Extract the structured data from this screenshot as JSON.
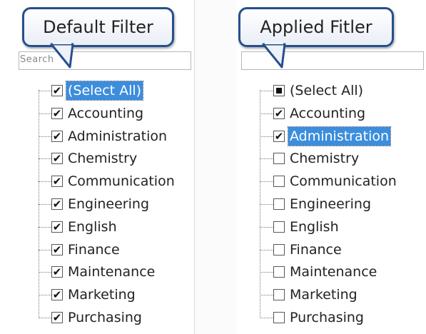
{
  "callouts": {
    "left": "Default Filter",
    "right": "Applied Fitler"
  },
  "search": {
    "ghost_label": "Search"
  },
  "left_list": [
    {
      "label": "(Select All)",
      "state": "checked",
      "selected": true
    },
    {
      "label": "Accounting",
      "state": "checked",
      "selected": false
    },
    {
      "label": "Administration",
      "state": "checked",
      "selected": false
    },
    {
      "label": "Chemistry",
      "state": "checked",
      "selected": false
    },
    {
      "label": "Communication",
      "state": "checked",
      "selected": false
    },
    {
      "label": "Engineering",
      "state": "checked",
      "selected": false
    },
    {
      "label": "English",
      "state": "checked",
      "selected": false
    },
    {
      "label": "Finance",
      "state": "checked",
      "selected": false
    },
    {
      "label": "Maintenance",
      "state": "checked",
      "selected": false
    },
    {
      "label": "Marketing",
      "state": "checked",
      "selected": false
    },
    {
      "label": "Purchasing",
      "state": "checked",
      "selected": false
    }
  ],
  "right_list": [
    {
      "label": "(Select All)",
      "state": "indeterminate",
      "selected": false
    },
    {
      "label": "Accounting",
      "state": "checked",
      "selected": false
    },
    {
      "label": "Administration",
      "state": "checked",
      "selected": true
    },
    {
      "label": "Chemistry",
      "state": "unchecked",
      "selected": false
    },
    {
      "label": "Communication",
      "state": "unchecked",
      "selected": false
    },
    {
      "label": "Engineering",
      "state": "unchecked",
      "selected": false
    },
    {
      "label": "English",
      "state": "unchecked",
      "selected": false
    },
    {
      "label": "Finance",
      "state": "unchecked",
      "selected": false
    },
    {
      "label": "Maintenance",
      "state": "unchecked",
      "selected": false
    },
    {
      "label": "Marketing",
      "state": "unchecked",
      "selected": false
    },
    {
      "label": "Purchasing",
      "state": "unchecked",
      "selected": false
    }
  ],
  "colors": {
    "selection": "#3c8ddc",
    "callout_border": "#264f8e"
  }
}
